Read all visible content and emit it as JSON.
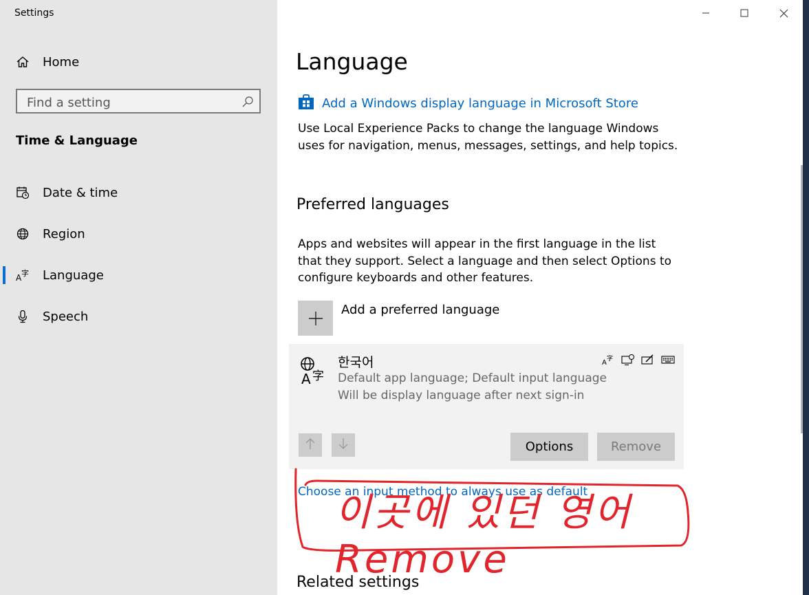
{
  "window": {
    "title": "Settings"
  },
  "sidebar": {
    "home_label": "Home",
    "search_placeholder": "Find a setting",
    "section_heading": "Time & Language",
    "items": [
      {
        "label": "Date & time",
        "icon": "calendar-clock-icon",
        "active": false
      },
      {
        "label": "Region",
        "icon": "globe-icon",
        "active": false
      },
      {
        "label": "Language",
        "icon": "language-icon",
        "active": true
      },
      {
        "label": "Speech",
        "icon": "microphone-icon",
        "active": false
      }
    ]
  },
  "main": {
    "title": "Language",
    "store_link": "Add a Windows display language in Microsoft Store",
    "store_description": "Use Local Experience Packs to change the language Windows uses for navigation, menus, messages, settings, and help topics.",
    "preferred_heading": "Preferred languages",
    "preferred_description": "Apps and websites will appear in the first language in the list that they support. Select a language and then select Options to configure keyboards and other features.",
    "add_language_label": "Add a preferred language",
    "language_card": {
      "name": "한국어",
      "line1": "Default app language; Default input language",
      "line2": "Will be display language after next sign-in",
      "options_label": "Options",
      "remove_label": "Remove",
      "feature_icons": [
        "display-language-icon",
        "speech-icon",
        "handwriting-icon",
        "keyboard-icon"
      ]
    },
    "input_method_link": "Choose an input method to always use as default",
    "related_heading": "Related settings"
  },
  "annotation": {
    "handwritten_text": "이곳에 있던 영어 Remove",
    "color": "#e0262c"
  },
  "colors": {
    "accent": "#0067c0",
    "sidebar_bg": "#e6e6e6",
    "card_bg": "#f2f2f2",
    "button_bg": "#cccccc"
  }
}
